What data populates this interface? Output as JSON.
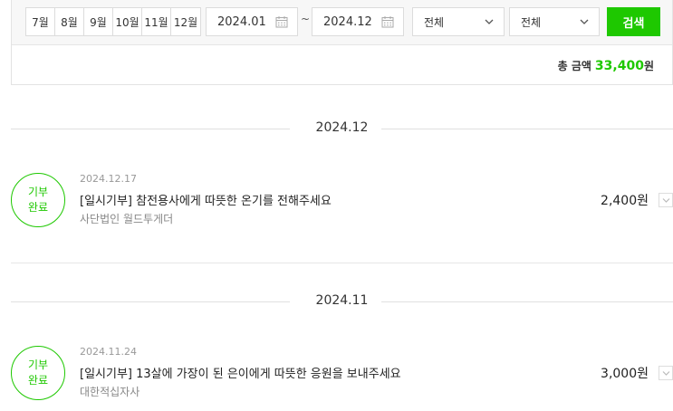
{
  "filter": {
    "months": [
      "7월",
      "8월",
      "9월",
      "10월",
      "11월",
      "12월"
    ],
    "start_date": "2024.01",
    "end_date": "2024.12",
    "range_separator": "~",
    "select1": "전체",
    "select2": "전체",
    "search_label": "검색"
  },
  "summary": {
    "total_label": "총 금액",
    "total_amount": "33,400",
    "currency": "원"
  },
  "groups": [
    {
      "month": "2024.12",
      "items": [
        {
          "badge_line1": "기부",
          "badge_line2": "완료",
          "date": "2024.12.17",
          "title": "[일시기부] 참전용사에게 따뜻한 온기를 전해주세요",
          "org": "사단법인 월드투게더",
          "amount": "2,400원"
        }
      ]
    },
    {
      "month": "2024.11",
      "items": [
        {
          "badge_line1": "기부",
          "badge_line2": "완료",
          "date": "2024.11.24",
          "title": "[일시기부] 13살에 가장이 된 은이에게 따뜻한 응원을 보내주세요",
          "org": "대한적십자사",
          "amount": "3,000원"
        }
      ]
    }
  ],
  "colors": {
    "accent": "#1ec800",
    "border": "#dcdcdc",
    "panel_bg": "#f7f7f7"
  },
  "icons": [
    "calendar-icon",
    "chevron-down-icon"
  ]
}
